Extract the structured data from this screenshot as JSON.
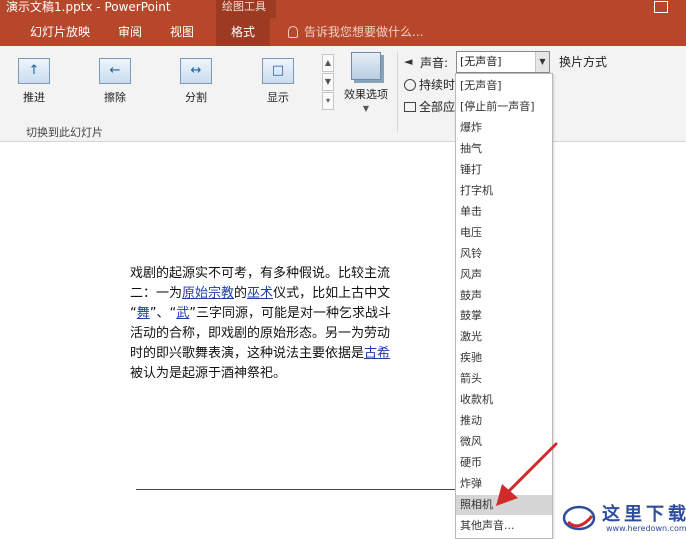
{
  "window": {
    "title": "演示文稿1.pptx - PowerPoint",
    "tool_group": "绘图工具"
  },
  "tabs": [
    {
      "label": "幻灯片放映",
      "active": false
    },
    {
      "label": "审阅",
      "active": false
    },
    {
      "label": "视图",
      "active": false
    },
    {
      "label": "格式",
      "active": true
    }
  ],
  "tell_me": "告诉我您想要做什么...",
  "ribbon": {
    "transitions": [
      {
        "label": "推进",
        "icon": "push-up-icon"
      },
      {
        "label": "擦除",
        "icon": "wipe-left-icon"
      },
      {
        "label": "分割",
        "icon": "split-icon"
      },
      {
        "label": "显示",
        "icon": "reveal-icon"
      }
    ],
    "effects_label": "效果选项",
    "group_label": "切换到此幻灯片",
    "sound_label": "声音:",
    "sound_value": "[无声音]",
    "duration_label": "持续时",
    "apply_all_label": "全部应",
    "advance_label": "换片方式"
  },
  "sound_options": [
    "[无声音]",
    "[停止前一声音]",
    "爆炸",
    "抽气",
    "锤打",
    "打字机",
    "单击",
    "电压",
    "风铃",
    "风声",
    "鼓声",
    "鼓掌",
    "激光",
    "疾驰",
    "箭头",
    "收款机",
    "推动",
    "微风",
    "硬币",
    "炸弹",
    "照相机",
    "其他声音..."
  ],
  "highlighted_option": "照相机",
  "slide": {
    "line1": "戏剧的起源实不可考，有多种假说。比较主流",
    "line2_pre": "二：一为",
    "line2_link1": "原始宗教",
    "line2_mid": "的",
    "line2_link2": "巫术",
    "line2_post": "仪式，比如上古中文",
    "line3_q1": "“",
    "line3_link1": "舞",
    "line3_mid": "”、“",
    "line3_link2": "武",
    "line3_post": "”三字同源，可能是对一种乞求战斗",
    "line4": "活动的合称，即戏剧的原始形态。另一为劳动",
    "line5_pre": "时的即兴歌舞表演，这种说法主要依据是",
    "line5_link": "古希",
    "line6": "被认为是起源于酒神祭祀。"
  },
  "watermark": {
    "text": "这里下载",
    "url": "www.heredown.com"
  },
  "colors": {
    "accent": "#b7472a",
    "accent_dark": "#9c3a22",
    "annotation_arrow": "#d22a2a",
    "link": "#1f3fa8"
  }
}
